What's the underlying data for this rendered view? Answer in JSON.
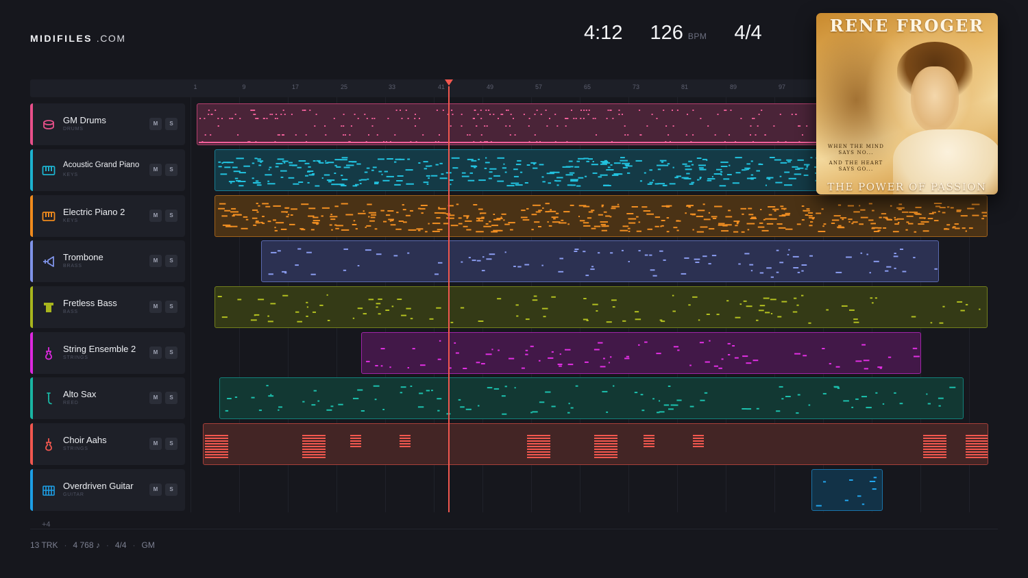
{
  "brand": {
    "name": "MIDIFILES",
    "suffix": ".COM"
  },
  "transport": {
    "duration": "4:12",
    "tempo": "126",
    "tempo_unit": "BPM",
    "time_signature": "4/4"
  },
  "album": {
    "artist": "RENE FROGER",
    "tagline_1": "WHEN THE MIND",
    "tagline_2": "SAYS NO...",
    "tagline_3": "AND THE HEART",
    "tagline_4": "SAYS GO...",
    "title": "THE POWER OF PASSION"
  },
  "ruler": {
    "bars": [
      "1",
      "9",
      "17",
      "25",
      "33",
      "41",
      "49",
      "57",
      "65",
      "73",
      "81",
      "89",
      "97"
    ]
  },
  "tracks": [
    {
      "name": "GM Drums",
      "category": "DRUMS",
      "mute": "M",
      "solo": "S",
      "color": "#e8508a",
      "icon": "drum-icon"
    },
    {
      "name": "Acoustic Grand Piano",
      "category": "KEYS",
      "mute": "M",
      "solo": "S",
      "color": "#1db2cf",
      "icon": "piano-keys-icon"
    },
    {
      "name": "Electric Piano 2",
      "category": "KEYS",
      "mute": "M",
      "solo": "S",
      "color": "#ef8a1d",
      "icon": "piano-keys-icon"
    },
    {
      "name": "Trombone",
      "category": "BRASS",
      "mute": "M",
      "solo": "S",
      "color": "#7f93e8",
      "icon": "trombone-icon"
    },
    {
      "name": "Fretless Bass",
      "category": "BASS",
      "mute": "M",
      "solo": "S",
      "color": "#a8b51d",
      "icon": "bass-icon"
    },
    {
      "name": "String Ensemble 2",
      "category": "STRINGS",
      "mute": "M",
      "solo": "S",
      "color": "#dc28de",
      "icon": "strings-icon"
    },
    {
      "name": "Alto Sax",
      "category": "REED",
      "mute": "M",
      "solo": "S",
      "color": "#19b5a3",
      "icon": "sax-icon"
    },
    {
      "name": "Choir Aahs",
      "category": "STRINGS",
      "mute": "M",
      "solo": "S",
      "color": "#f0574f",
      "icon": "strings-icon"
    },
    {
      "name": "Overdriven Guitar",
      "category": "GUITAR",
      "mute": "M",
      "solo": "S",
      "color": "#1d9fe6",
      "icon": "guitar-icon"
    }
  ],
  "more_tracks": "+4",
  "footer": {
    "tracks": "13 TRK",
    "notes": "4 768 ♪",
    "signature": "4/4",
    "standard": "GM"
  }
}
